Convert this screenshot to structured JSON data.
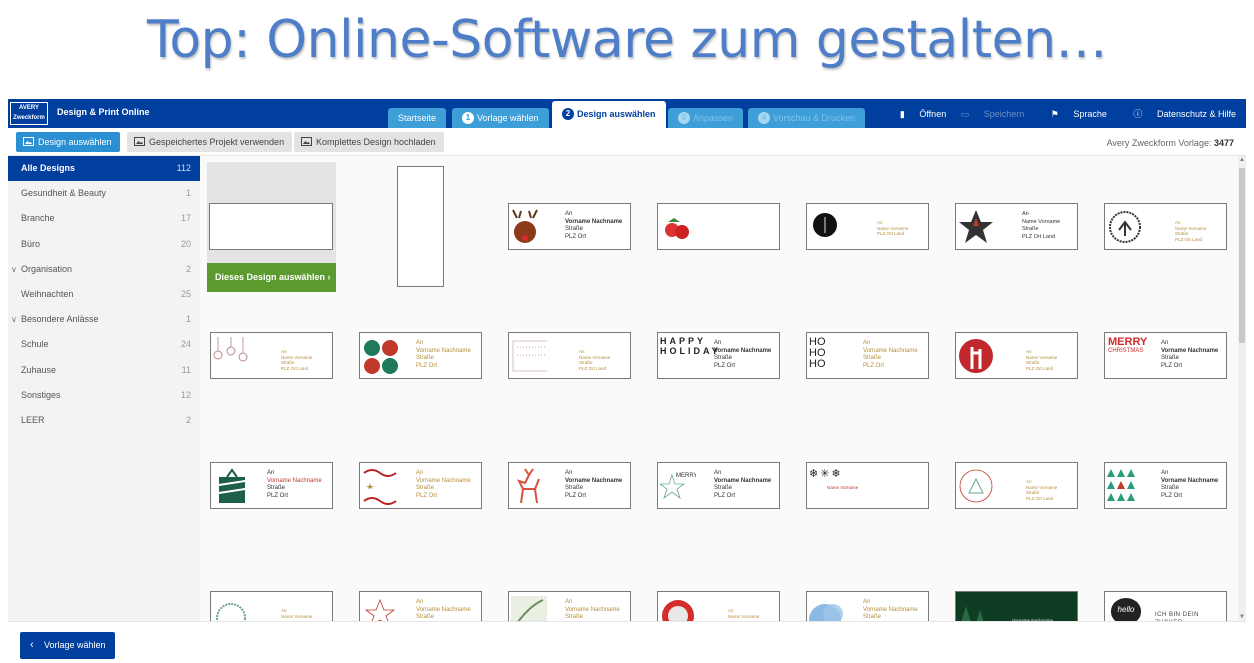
{
  "headline": "Top: Online-Software zum gestalten…",
  "topbar": {
    "logo_line1": "AVERY",
    "logo_line2": "Zweckform",
    "brand": "Design & Print Online",
    "steps": [
      {
        "label": "Startseite",
        "num": "",
        "state": "done"
      },
      {
        "label": "Vorlage wählen",
        "num": "1",
        "state": "done"
      },
      {
        "label": "Design auswählen",
        "num": "2",
        "state": "active"
      },
      {
        "label": "Anpassen",
        "num": "3",
        "state": "disabled"
      },
      {
        "label": "Vorschau & Drucken",
        "num": "4",
        "state": "disabled"
      }
    ],
    "menu": {
      "open": "Öffnen",
      "save": "Speichern",
      "language": "Sprache",
      "help": "Datenschutz & Hilfe"
    }
  },
  "toolbar": {
    "design_select": "Design auswählen",
    "saved_project": "Gespeichertes Projekt verwenden",
    "upload": "Komplettes Design hochladen",
    "vorlage_label": "Avery Zweckform Vorlage:",
    "vorlage_number": "3477"
  },
  "sidebar": {
    "items": [
      {
        "label": "Alle Designs",
        "count": "112"
      },
      {
        "label": "Gesundheit & Beauty",
        "count": "1"
      },
      {
        "label": "Branche",
        "count": "17"
      },
      {
        "label": "Büro",
        "count": "20"
      },
      {
        "label": "Organisation",
        "count": "2"
      },
      {
        "label": "Weihnachten",
        "count": "25"
      },
      {
        "label": "Besondere Anlässe",
        "count": "1"
      },
      {
        "label": "Schule",
        "count": "24"
      },
      {
        "label": "Zuhause",
        "count": "11"
      },
      {
        "label": "Sonstiges",
        "count": "12"
      },
      {
        "label": "LEER",
        "count": "2"
      }
    ]
  },
  "grid": {
    "select_button": "Dieses Design auswählen",
    "card_an": "An",
    "card_name": "Vorname Nachname",
    "card_street": "Straße",
    "card_city": "PLZ Ort",
    "card_name_small": "Name Vorname",
    "card_city_land": "PLZ Ort Land",
    "merry_text": "MERRY",
    "christmas_text": "CHRISTMAS",
    "happy_holiday": "HAPPY HOLIDAY",
    "hohoho": "HO HO HO",
    "hello_text": "hello",
    "zucker_text": "ICH BIN DEIN ZUCKER"
  },
  "footer": {
    "back": "Vorlage wählen"
  },
  "colors": {
    "brand": "#003f9e",
    "accent": "#2b8fd3",
    "select": "#5b9a2f",
    "headline": "#4f7ec8"
  }
}
